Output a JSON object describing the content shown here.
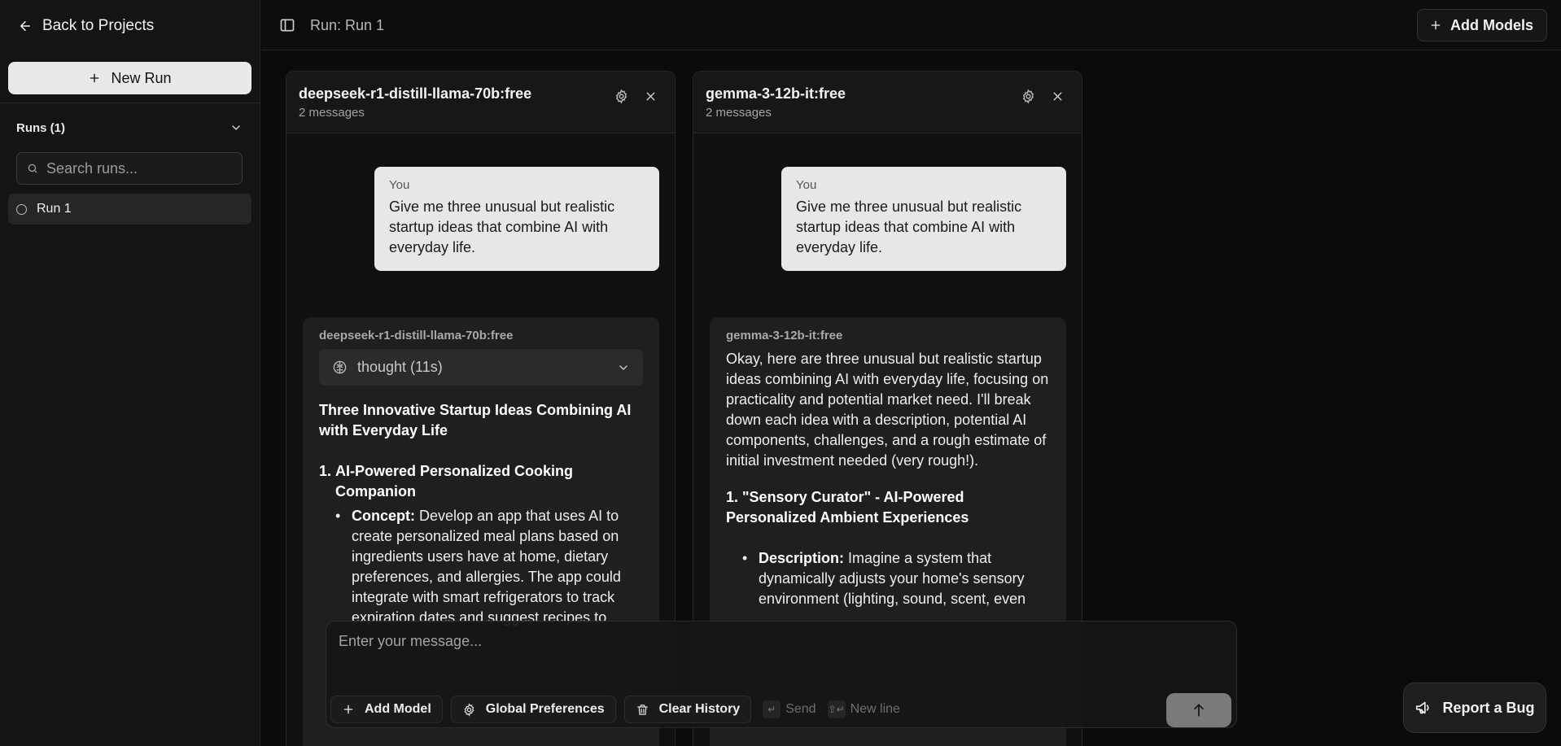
{
  "sidebar": {
    "back_label": "Back to Projects",
    "new_run_label": "New Run",
    "runs_header": "Runs (1)",
    "search_placeholder": "Search runs...",
    "runs": [
      {
        "label": "Run 1"
      }
    ]
  },
  "topbar": {
    "title": "Run: Run 1",
    "add_models_label": "Add Models"
  },
  "panels": [
    {
      "model": "deepseek-r1-distill-llama-70b:free",
      "count": "2 messages",
      "you_label": "You",
      "prompt": "Give me three unusual but realistic startup ideas that combine AI with everyday life.",
      "response_model": "deepseek-r1-distill-llama-70b:free",
      "thought_label": "thought (11s)",
      "heading": "Three Innovative Startup Ideas Combining AI with Everyday Life",
      "item1_num": "1.",
      "item1_title": "AI-Powered Personalized Cooking Companion",
      "bullet1_label": "Concept:",
      "bullet1_text": " Develop an app that uses AI to create personalized meal plans based on ingredients users have at home, dietary preferences, and allergies. The app could integrate with smart refrigerators to track expiration dates and suggest recipes to"
    },
    {
      "model": "gemma-3-12b-it:free",
      "count": "2 messages",
      "you_label": "You",
      "prompt": "Give me three unusual but realistic startup ideas that combine AI with everyday life.",
      "response_model": "gemma-3-12b-it:free",
      "intro": "Okay, here are three unusual but realistic startup ideas combining AI with everyday life, focusing on practicality and potential market need. I'll break down each idea with a description, potential AI components, challenges, and a rough estimate of initial investment needed (very rough!).",
      "section1": "1. \"Sensory Curator\" - AI-Powered Personalized Ambient Experiences",
      "bullet1_label": "Description:",
      "bullet1_text": " Imagine a system that dynamically adjusts your home's sensory environment (lighting, sound, scent, even"
    }
  ],
  "composer": {
    "placeholder": "Enter your message...",
    "add_model_label": "Add Model",
    "global_prefs_label": "Global Preferences",
    "clear_history_label": "Clear History",
    "send_hint": "Send",
    "newline_hint": "New line",
    "send_key": "↵",
    "newline_key": "⇧↵"
  },
  "report_bug_label": "Report a Bug"
}
